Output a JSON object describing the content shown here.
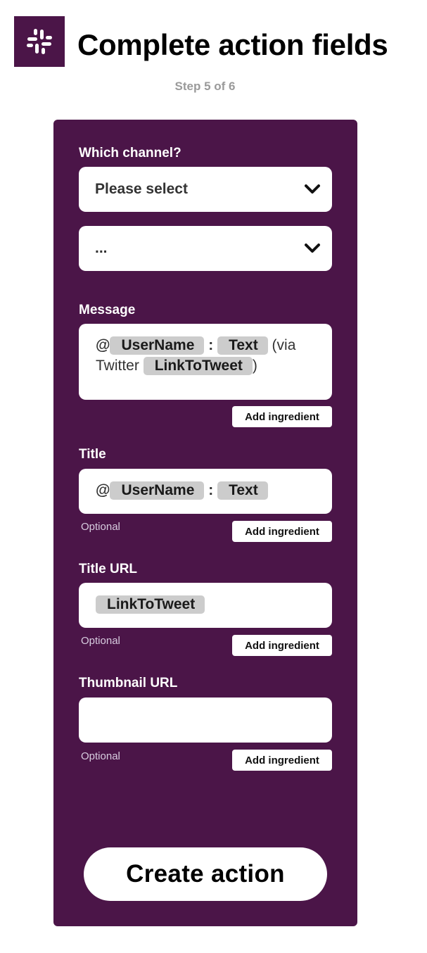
{
  "colors": {
    "brand": "#4b1548",
    "pill": "#cccccc",
    "optional": "#d8cde0"
  },
  "header": {
    "logo_icon": "slack-icon",
    "title": "Complete action fields",
    "step": "Step 5 of 6"
  },
  "form": {
    "channel": {
      "label": "Which channel?",
      "selected": "Please select",
      "sub_selected": "..."
    },
    "message": {
      "label": "Message",
      "at": "@",
      "ingredient_1": "UserName",
      "sep": ":",
      "ingredient_2": "Text",
      "text_1": "(via",
      "text_2": "Twitter",
      "ingredient_3": "LinkToTweet",
      "close": ")",
      "add_label": "Add ingredient"
    },
    "title": {
      "label": "Title",
      "at": "@",
      "ingredient_1": "UserName",
      "sep": ":",
      "ingredient_2": "Text",
      "optional": "Optional",
      "add_label": "Add ingredient"
    },
    "title_url": {
      "label": "Title URL",
      "ingredient_1": "LinkToTweet",
      "optional": "Optional",
      "add_label": "Add ingredient"
    },
    "thumbnail_url": {
      "label": "Thumbnail URL",
      "value": "",
      "optional": "Optional",
      "add_label": "Add ingredient"
    },
    "submit_label": "Create action"
  }
}
